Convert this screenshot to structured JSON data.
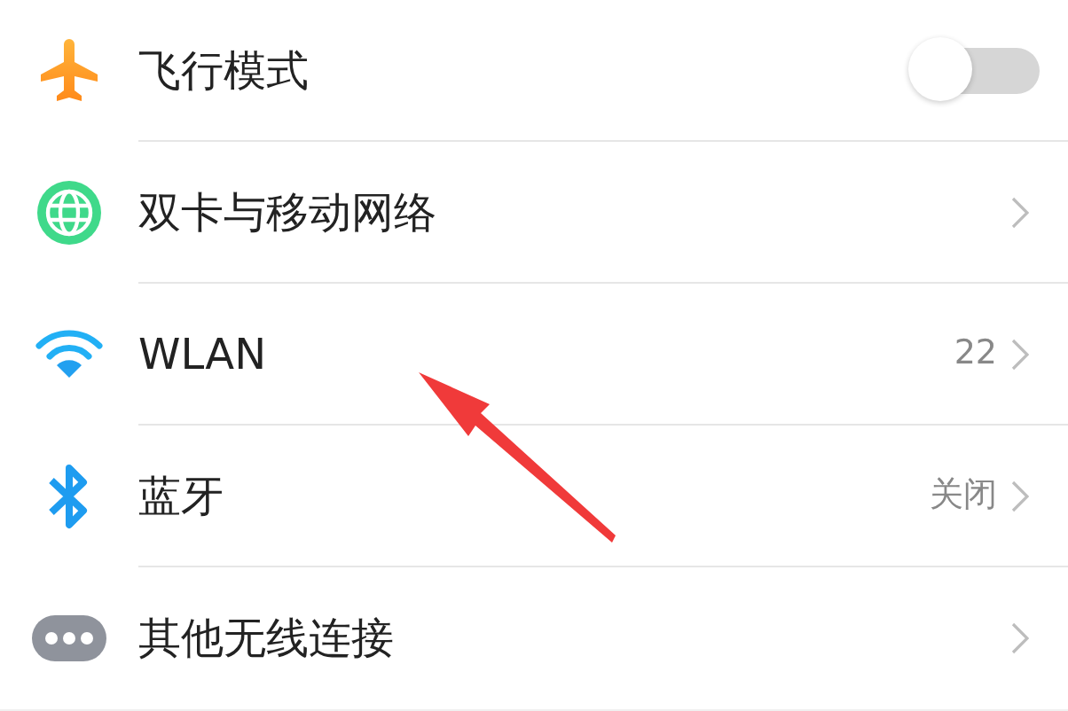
{
  "settings": [
    {
      "kind": "toggle",
      "label": "飞行模式",
      "on": false
    },
    {
      "kind": "link",
      "label": "双卡与移动网络"
    },
    {
      "kind": "link",
      "label": "WLAN",
      "value": "22"
    },
    {
      "kind": "link",
      "label": "蓝牙",
      "value": "关闭"
    },
    {
      "kind": "link",
      "label": "其他无线连接"
    }
  ],
  "annotations": [
    {
      "kind": "arrow",
      "color": "#f03a3a"
    }
  ]
}
